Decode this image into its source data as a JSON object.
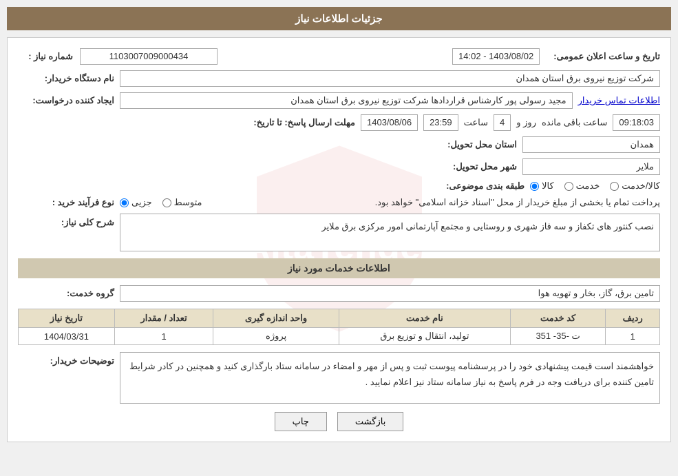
{
  "header": {
    "title": "جزئیات اطلاعات نیاز"
  },
  "fields": {
    "need_number_label": "شماره نیاز :",
    "need_number_value": "1103007009000434",
    "buyer_name_label": "نام دستگاه خریدار:",
    "buyer_name_value": "شرکت توزیع نیروی برق استان همدان",
    "creator_label": "ایجاد کننده درخواست:",
    "creator_value": "مجید رسولی پور کارشناس قراردادها شرکت توزیع نیروی برق استان همدان",
    "creator_link": "اطلاعات تماس خریدار",
    "deadline_label": "مهلت ارسال پاسخ: تا تاریخ:",
    "deadline_date": "1403/08/06",
    "deadline_time_label": "ساعت",
    "deadline_time": "23:59",
    "deadline_days_label": "روز و",
    "deadline_days": "4",
    "deadline_remaining_label": "ساعت باقی مانده",
    "deadline_remaining": "09:18:03",
    "province_label": "استان محل تحویل:",
    "province_value": "همدان",
    "city_label": "شهر محل تحویل:",
    "city_value": "ملایر",
    "category_label": "طبقه بندی موضوعی:",
    "category_radio1": "کالا",
    "category_radio2": "خدمت",
    "category_radio3": "کالا/خدمت",
    "process_label": "نوع فرآیند خرید :",
    "process_radio1": "جزیی",
    "process_radio2": "متوسط",
    "process_note": "پرداخت تمام یا بخشی از مبلغ خریدار از محل \"اسناد خزانه اسلامی\" خواهد بود.",
    "description_label": "شرح کلی نیاز:",
    "description_value": "نصب کنتور های تکفاز و سه فاز شهری و روستایی و مجتمع آپارتمانی امور مرکزی برق ملایر",
    "services_section_title": "اطلاعات خدمات مورد نیاز",
    "service_group_label": "گروه خدمت:",
    "service_group_value": "تامین برق، گاز، بخار و تهویه هوا",
    "table": {
      "headers": [
        "ردیف",
        "کد خدمت",
        "نام خدمت",
        "واحد اندازه گیری",
        "تعداد / مقدار",
        "تاریخ نیاز"
      ],
      "rows": [
        {
          "row": "1",
          "code": "ت -35- 351",
          "service": "تولید، انتقال و توزیع برق",
          "unit": "پروژه",
          "count": "1",
          "date": "1404/03/31"
        }
      ]
    },
    "buyer_desc_label": "توضیحات خریدار:",
    "buyer_desc_value": "خواهشمند است  قیمت پیشنهادی خود را در پرسشنامه پیوست ثبت و پس از مهر و امضاء در سامانه ستاد بارگذاری کنید  و  همچنین  در کادر شرایط تامین کننده برای دریافت وجه در فرم پاسخ به نیاز سامانه ستاد نیز اعلام نمایید ."
  },
  "datetime_row": {
    "announce_label": "تاریخ و ساعت اعلان عمومی:",
    "announce_value": "1403/08/02 - 14:02"
  },
  "buttons": {
    "back": "بازگشت",
    "print": "چاپ"
  }
}
